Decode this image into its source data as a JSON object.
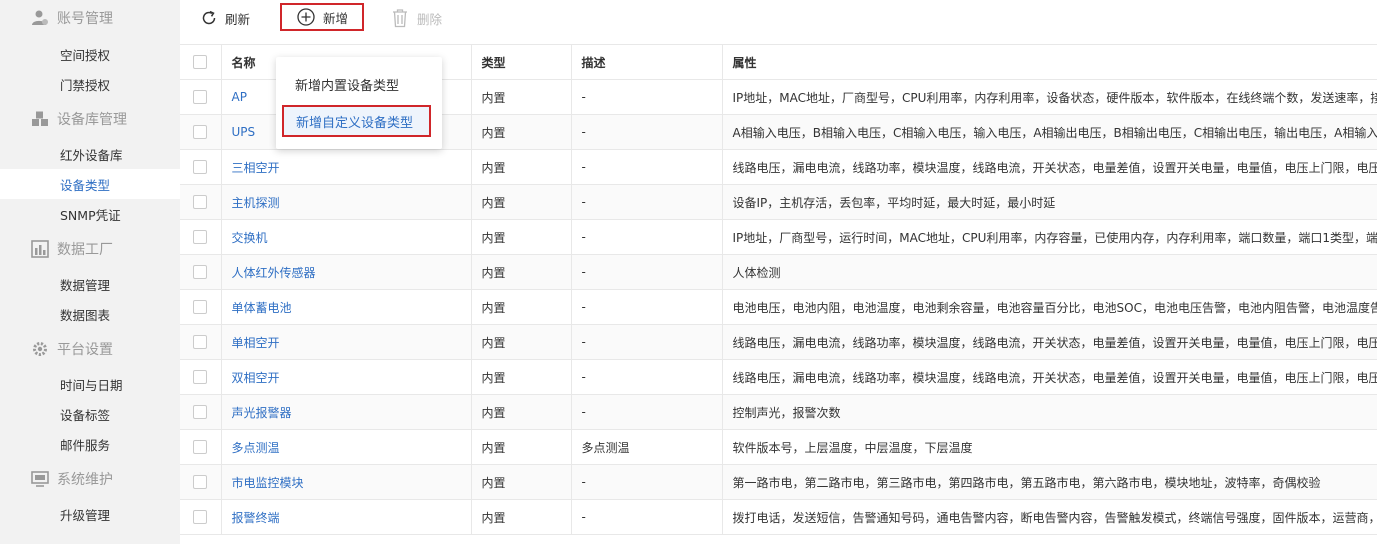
{
  "sidebar": {
    "groups": [
      {
        "label": "账号管理",
        "icon": "user-icon",
        "items": [
          "空间授权",
          "门禁授权"
        ]
      },
      {
        "label": "设备库管理",
        "icon": "cubes-icon",
        "items": [
          "红外设备库",
          "设备类型",
          "SNMP凭证"
        ]
      },
      {
        "label": "数据工厂",
        "icon": "chart-icon",
        "items": [
          "数据管理",
          "数据图表"
        ]
      },
      {
        "label": "平台设置",
        "icon": "gear-icon",
        "items": [
          "时间与日期",
          "设备标签",
          "邮件服务"
        ]
      },
      {
        "label": "系统维护",
        "icon": "monitor-icon",
        "items": [
          "升级管理"
        ]
      }
    ],
    "active_item": "设备类型"
  },
  "toolbar": {
    "refresh_label": "刷新",
    "add_label": "新增",
    "delete_label": "删除"
  },
  "dropdown": {
    "items": [
      "新增内置设备类型",
      "新增自定义设备类型"
    ]
  },
  "table": {
    "headers": {
      "name": "名称",
      "type": "类型",
      "desc": "描述",
      "attrs": "属性"
    },
    "rows": [
      {
        "name": "AP",
        "type": "内置",
        "desc": "-",
        "attrs": "IP地址，MAC地址，厂商型号，CPU利用率，内存利用率，设备状态，硬件版本，软件版本，在线终端个数，发送速率，接"
      },
      {
        "name": "UPS",
        "type": "内置",
        "desc": "-",
        "attrs": "A相输入电压，B相输入电压，C相输入电压，输入电压，A相输出电压，B相输出电压，C相输出电压，输出电压，A相输入电"
      },
      {
        "name": "三相空开",
        "type": "内置",
        "desc": "-",
        "attrs": "线路电压，漏电电流，线路功率，模块温度，线路电流，开关状态，电量差值，设置开关电量，电量值，电压上门限，电压"
      },
      {
        "name": "主机探测",
        "type": "内置",
        "desc": "-",
        "attrs": "设备IP，主机存活，丢包率，平均时延，最大时延，最小时延"
      },
      {
        "name": "交换机",
        "type": "内置",
        "desc": "-",
        "attrs": "IP地址，厂商型号，运行时间，MAC地址，CPU利用率，内存容量，已使用内存，内存利用率，端口数量，端口1类型，端"
      },
      {
        "name": "人体红外传感器",
        "type": "内置",
        "desc": "-",
        "attrs": "人体检测"
      },
      {
        "name": "单体蓄电池",
        "type": "内置",
        "desc": "-",
        "attrs": "电池电压，电池内阻，电池温度，电池剩余容量，电池容量百分比，电池SOC，电池电压告警，电池内阻告警，电池温度告"
      },
      {
        "name": "单相空开",
        "type": "内置",
        "desc": "-",
        "attrs": "线路电压，漏电电流，线路功率，模块温度，线路电流，开关状态，电量差值，设置开关电量，电量值，电压上门限，电压"
      },
      {
        "name": "双相空开",
        "type": "内置",
        "desc": "-",
        "attrs": "线路电压，漏电电流，线路功率，模块温度，线路电流，开关状态，电量差值，设置开关电量，电量值，电压上门限，电压"
      },
      {
        "name": "声光报警器",
        "type": "内置",
        "desc": "-",
        "attrs": "控制声光，报警次数"
      },
      {
        "name": "多点测温",
        "type": "内置",
        "desc": "多点测温",
        "attrs": "软件版本号，上层温度，中层温度，下层温度"
      },
      {
        "name": "市电监控模块",
        "type": "内置",
        "desc": "-",
        "attrs": "第一路市电，第二路市电，第三路市电，第四路市电，第五路市电，第六路市电，模块地址，波特率，奇偶校验"
      },
      {
        "name": "报警终端",
        "type": "内置",
        "desc": "-",
        "attrs": "拨打电话，发送短信，告警通知号码，通电告警内容，断电告警内容，告警触发模式，终端信号强度，固件版本，运营商，"
      }
    ]
  }
}
